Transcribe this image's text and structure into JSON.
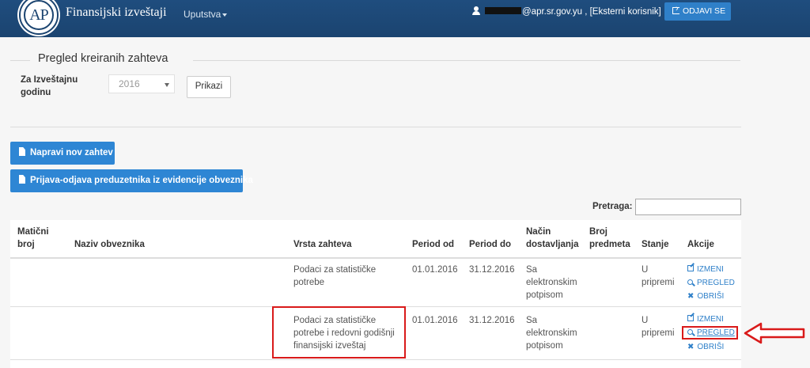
{
  "header": {
    "logo_text": "AP",
    "app_title": "Finansijski izveštaji",
    "menu_label": "Uputstva",
    "user_text": "@apr.sr.gov.yu , [Eksterni korisnik]",
    "logout_label": "ODJAVI SE"
  },
  "filter": {
    "legend": "Pregled kreiranih zahteva",
    "year_label": "Za Izveštajnu godinu",
    "year_value": "2016",
    "show_label": "Prikazi"
  },
  "actions": {
    "new_request": "Napravi nov zahtev",
    "register": "Prijava-odjava preduzetnika iz evidencije obveznika"
  },
  "search": {
    "label": "Pretraga:"
  },
  "table": {
    "columns": [
      "Matični broj",
      "Naziv obveznika",
      "Vrsta zahteva",
      "Period od",
      "Period do",
      "Način dostavljanja",
      "Broj predmeta",
      "Stanje",
      "Akcije"
    ],
    "rows": [
      {
        "type": "Podaci za statističke potrebe",
        "from": "01.01.2016",
        "to": "31.12.2016",
        "delivery": "Sa elektronskim potpisom",
        "state": "U pripremi",
        "edit": "IZMENI",
        "view": "PREGLED",
        "delete": "OBRIŠI"
      },
      {
        "type": "Podaci za statističke potrebe i redovni godišnji finansijski izveštaj",
        "from": "01.01.2016",
        "to": "31.12.2016",
        "delivery": "Sa elektronskim potpisom",
        "state": "U pripremi",
        "edit": "IZMENI",
        "view": "PREGLED",
        "delete": "OBRIŠI"
      }
    ]
  },
  "colors": {
    "header_bg": "#1f4d7e",
    "primary_button": "#2e86d4",
    "link": "#2f80c9",
    "highlight": "#d91a1a"
  }
}
